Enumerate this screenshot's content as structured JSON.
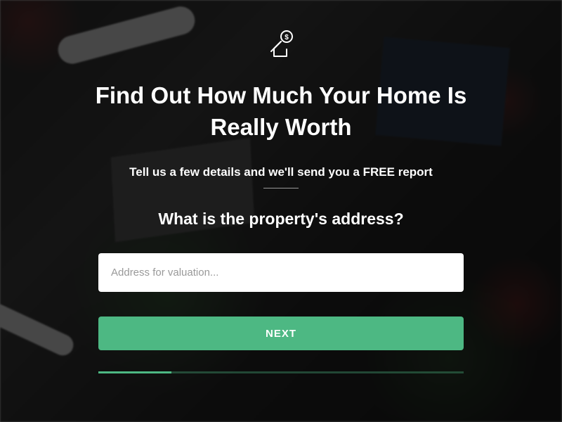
{
  "header": {
    "title": "Find Out How Much Your Home Is Really Worth",
    "subtitle": "Tell us a few details and we'll send you a FREE report"
  },
  "form": {
    "question": "What is the property's address?",
    "address_placeholder": "Address for valuation...",
    "address_value": "",
    "next_button_label": "NEXT"
  },
  "progress": {
    "percent": 20
  },
  "colors": {
    "accent": "#4db883"
  },
  "icons": {
    "main": "home-value-icon"
  }
}
